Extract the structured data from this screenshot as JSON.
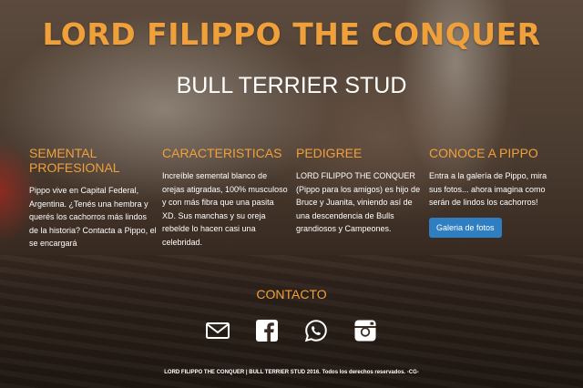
{
  "header": {
    "title": "LORD FILIPPO THE CONQUER",
    "subtitle": "BULL TERRIER STUD"
  },
  "columns": [
    {
      "heading": "SEMENTAL PROFESIONAL",
      "text": "Pippo vive en Capital Federal, Argentina. ¿Tenés una hembra y querés los cachorros más lindos de la historia? Contacta a Pippo, el se encargará"
    },
    {
      "heading": "CARACTERISTICAS",
      "text": "Increíble semental blanco de orejas atigradas, 100% musculoso y con más fibra que una pasita XD. Sus manchas y su oreja rebelde lo hacen casi una celebridad."
    },
    {
      "heading": "PEDIGREE",
      "text": "LORD FILIPPO THE CONQUER (Pippo para los amigos) es hijo de Bruce y Juanita, viniendo así de una descendencia de Bulls grandiosos y Campeones."
    },
    {
      "heading": "CONOCE A PIPPO",
      "text": "Entra a la galería de Pippo, mira sus fotos... ahora imagina como serán de lindos los cachorros!",
      "button_label": "Galeria de fotos"
    }
  ],
  "contact": {
    "title": "CONTACTO",
    "icons": [
      "mail-icon",
      "facebook-icon",
      "whatsapp-icon",
      "instagram-icon"
    ]
  },
  "footer": {
    "text": "LORD FILIPPO THE CONQUER | BULL TERRIER STUD 2016. Todos los derechos reservados. -CG-"
  },
  "colors": {
    "accent": "#f0a03a",
    "button": "#2f7ec1",
    "text": "#ffffff"
  }
}
